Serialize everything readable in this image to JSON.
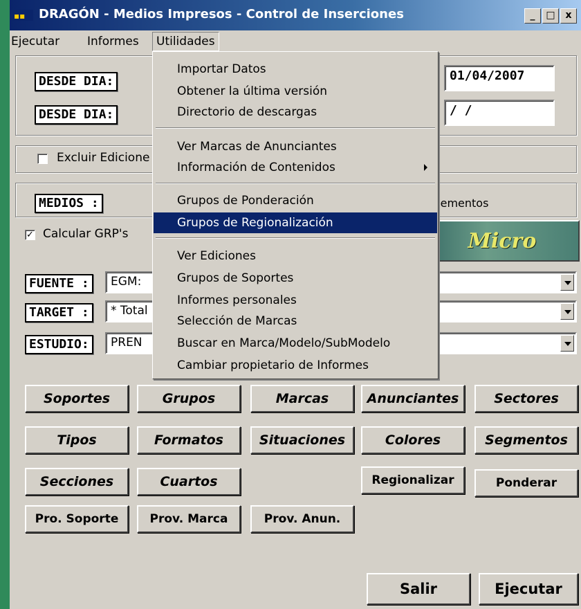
{
  "window": {
    "title": "DRAGÓN - Medios Impresos - Control de Inserciones",
    "min_label": "_",
    "max_label": "□",
    "close_label": "x"
  },
  "menubar": {
    "items": [
      "Ejecutar",
      "Informes",
      "Utilidades"
    ]
  },
  "dates": {
    "desde1_label": "DESDE DIA:",
    "desde2_label": "DESDE DIA:",
    "desde1_value": "01/04/2007",
    "desde2_value": " / /"
  },
  "excluir_label": "Excluir Edicione",
  "medios": {
    "label": "MEDIOS :",
    "right_text": "plementos"
  },
  "grp": {
    "label": "Calcular GRP's",
    "checked": "✓"
  },
  "micro_label": "Micro",
  "filters": {
    "fuente_label": "FUENTE :",
    "fuente_value": "EGM:",
    "target_label": "TARGET :",
    "target_value": "* Total",
    "estudio_label": "ESTUDIO:",
    "estudio_value": "PREN"
  },
  "buttons": {
    "row1": [
      "Soportes",
      "Grupos",
      "Marcas",
      "Anunciantes",
      "Sectores"
    ],
    "row2": [
      "Tipos",
      "Formatos",
      "Situaciones",
      "Colores",
      "Segmentos"
    ],
    "row3": [
      "Secciones",
      "Cuartos",
      "Regionalizar",
      "Ponderar"
    ],
    "row4": [
      "Pro. Soporte",
      "Prov. Marca",
      "Prov. Anun."
    ],
    "salir": "Salir",
    "ejecutar": "Ejecutar"
  },
  "menu_utilidades": {
    "items": [
      "Importar Datos",
      "Obtener la última versión",
      "Directorio de descargas",
      "Ver Marcas de Anunciantes",
      "Información de Contenidos",
      "Grupos de Ponderación",
      "Grupos de Regionalización",
      "Ver Ediciones",
      "Grupos de Soportes",
      "Informes personales",
      "Selección de Marcas",
      "Buscar en Marca/Modelo/SubModelo",
      "Cambiar propietario de Informes"
    ],
    "highlighted": "Grupos de Regionalización"
  },
  "colors": {
    "background": "#2f8a5a",
    "window": "#d4d0c8",
    "highlight": "#0a246a",
    "titlebar_start": "#0a246a"
  }
}
